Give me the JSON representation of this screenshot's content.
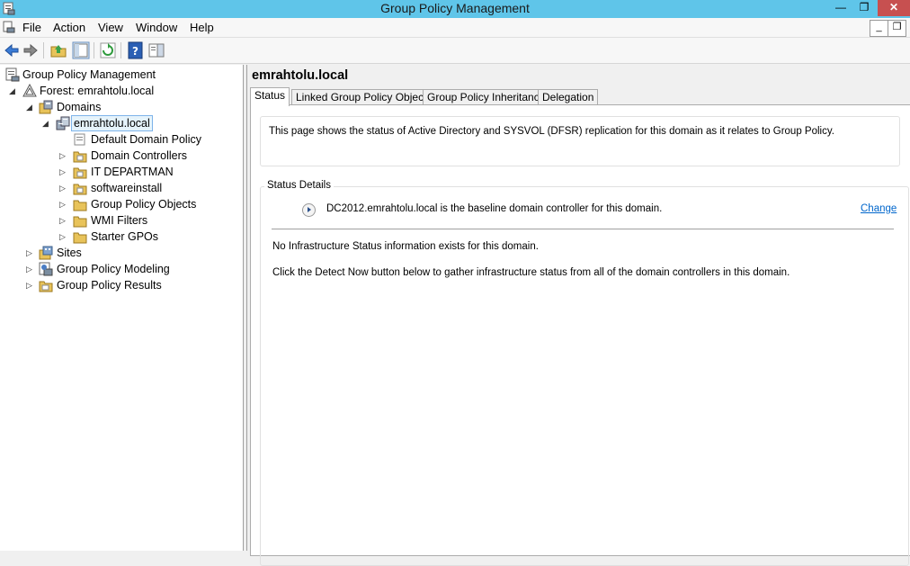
{
  "window": {
    "title": "Group Policy Management",
    "minimize": "—",
    "restore": "❐",
    "close": "✕"
  },
  "menu": {
    "items": [
      "File",
      "Action",
      "View",
      "Window",
      "Help"
    ],
    "mdi_minimize": "_",
    "mdi_restore": "❐"
  },
  "toolbar": {
    "icons": [
      "back-icon",
      "forward-icon",
      "up-folder-icon",
      "show-hide-tree-icon",
      "refresh-icon",
      "help-icon",
      "action-pane-icon"
    ]
  },
  "tree": {
    "root": "Group Policy Management",
    "forest": "Forest: emrahtolu.local",
    "domains": "Domains",
    "domain": "emrahtolu.local",
    "children": [
      "Default Domain Policy",
      "Domain Controllers",
      "IT DEPARTMAN",
      "softwareinstall",
      "Group Policy Objects",
      "WMI Filters",
      "Starter GPOs"
    ],
    "sites": "Sites",
    "modeling": "Group Policy Modeling",
    "results": "Group Policy Results"
  },
  "content": {
    "heading": "emrahtolu.local",
    "tabs": [
      "Status",
      "Linked Group Policy Objects",
      "Group Policy Inheritance",
      "Delegation"
    ],
    "active_tab": "Status",
    "info": "This page shows the status of Active Directory and SYSVOL (DFSR) replication for this domain as it relates to Group Policy.",
    "status_details_label": "Status Details",
    "baseline": "DC2012.emrahtolu.local is the baseline domain controller for this domain.",
    "change_link": "Change",
    "no_info": "No Infrastructure Status information exists for this domain.",
    "detect_hint": "Click the Detect Now button below to gather infrastructure status from all of the domain controllers in this domain."
  }
}
